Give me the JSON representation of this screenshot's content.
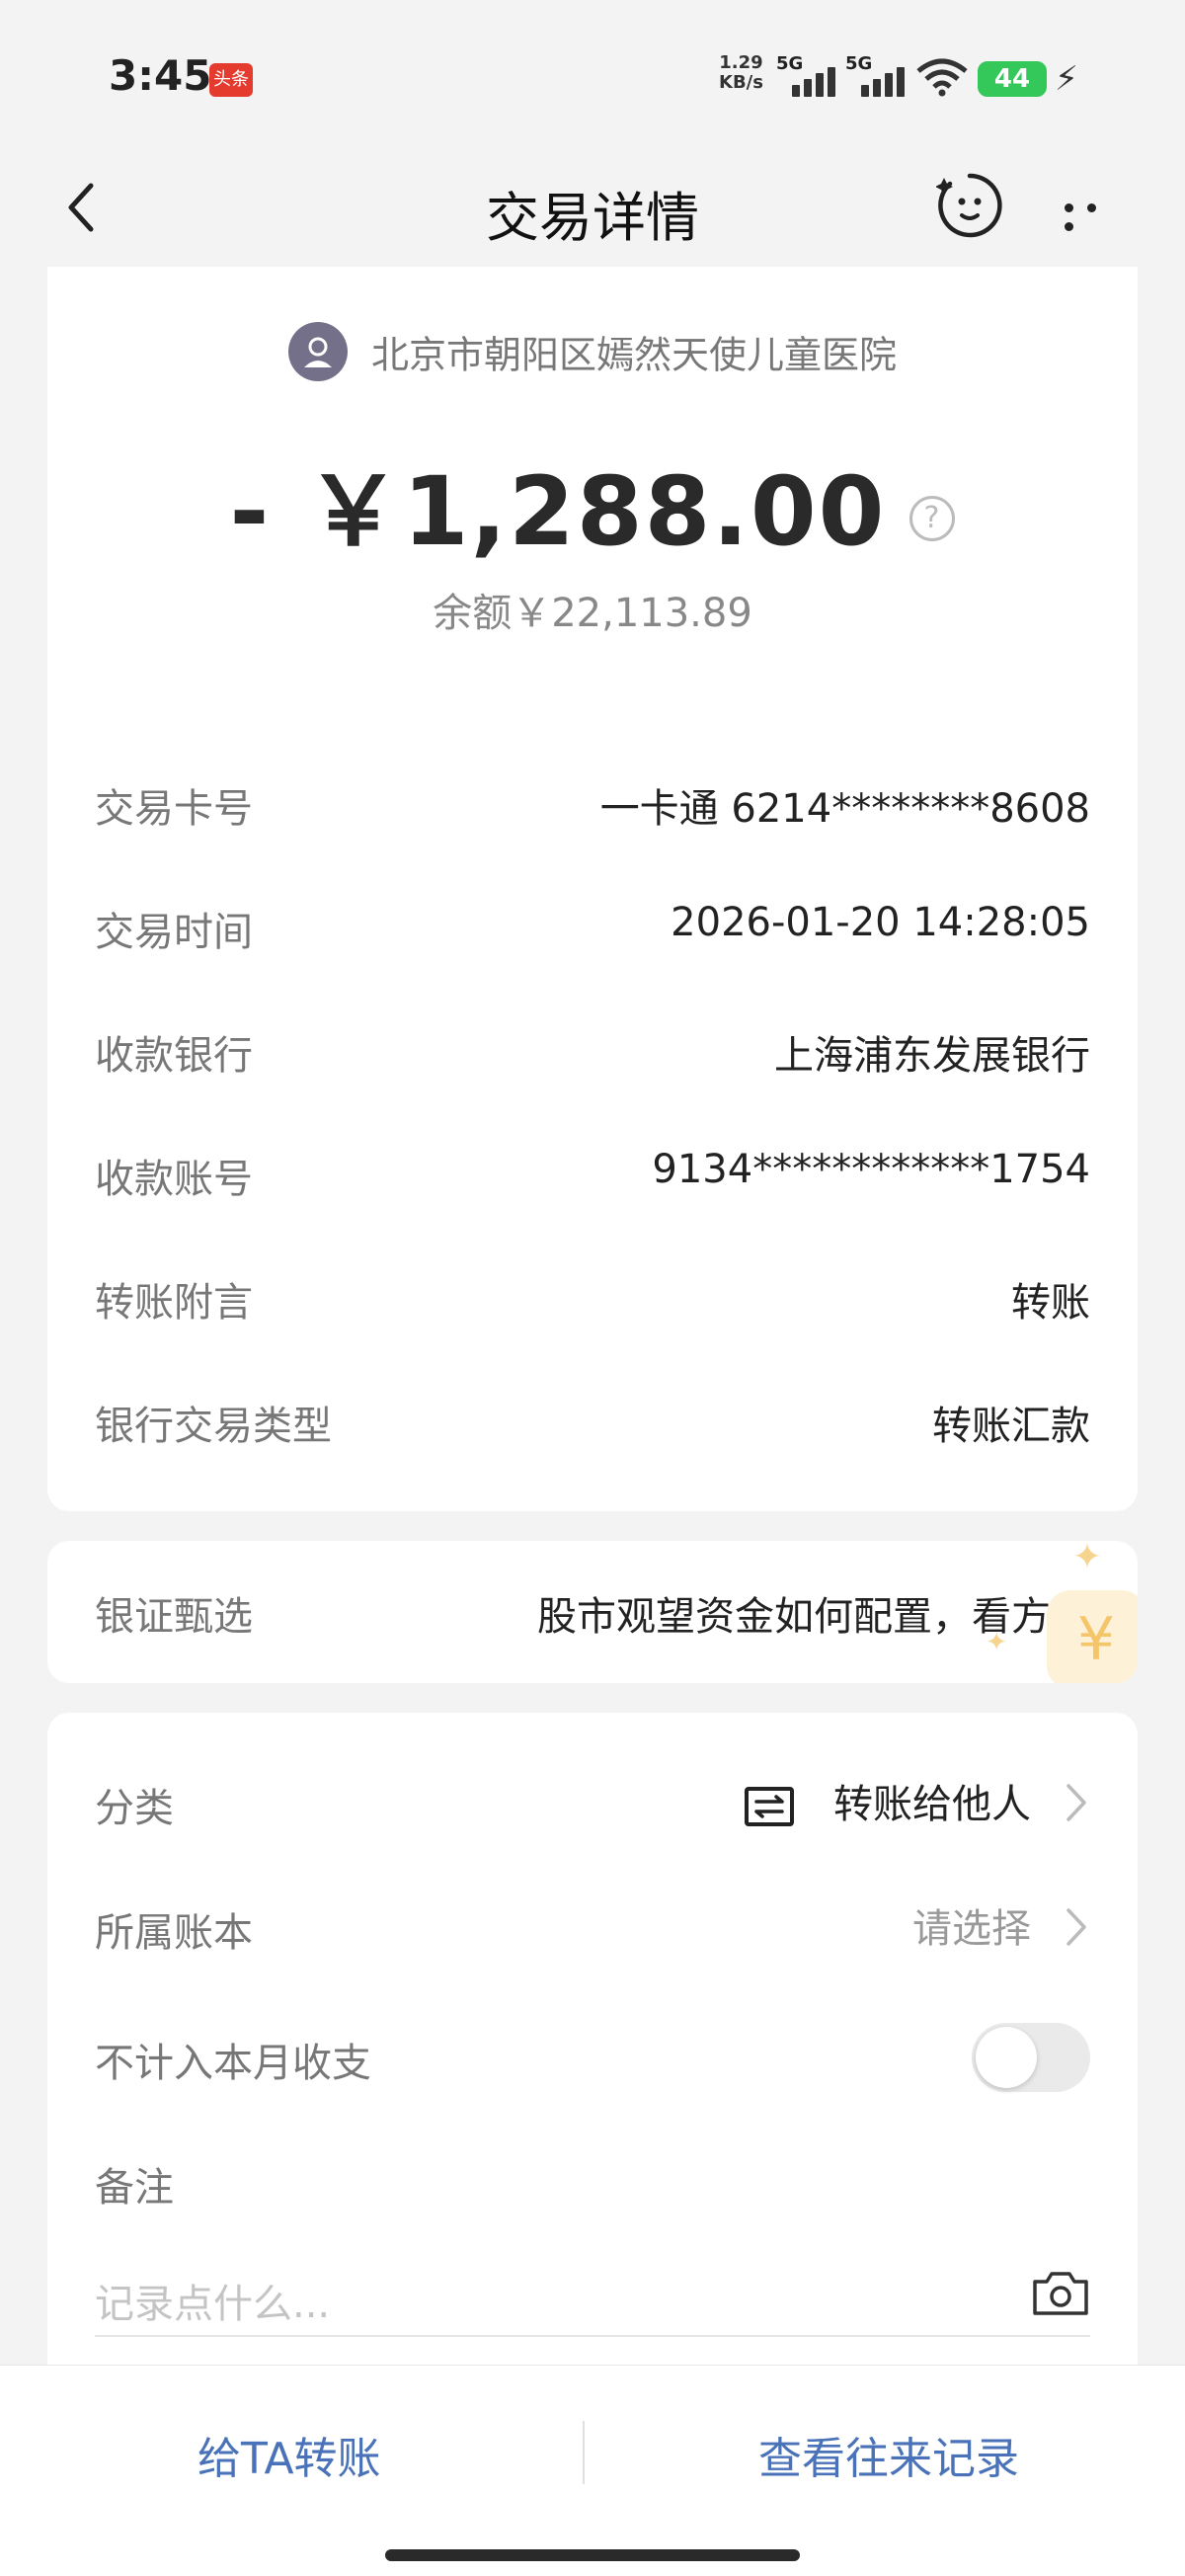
{
  "status_bar": {
    "time": "3:45",
    "app_badge": "头条",
    "net_speed_value": "1.29",
    "net_speed_unit": "KB/s",
    "sim1": "5G",
    "sim2": "5G",
    "battery": "44"
  },
  "nav": {
    "title": "交易详情"
  },
  "transaction": {
    "merchant": "北京市朝阳区嫣然天使儿童医院",
    "amount": "- ￥1,288.00",
    "balance": "余额￥22,113.89"
  },
  "details": [
    {
      "label": "交易卡号",
      "value": "一卡通 6214********8608"
    },
    {
      "label": "交易时间",
      "value": "2026-01-20 14:28:05"
    },
    {
      "label": "收款银行",
      "value": "上海浦东发展银行"
    },
    {
      "label": "收款账号",
      "value": "9134************1754"
    },
    {
      "label": "转账附言",
      "value": "转账"
    },
    {
      "label": "银行交易类型",
      "value": "转账汇款"
    }
  ],
  "promo": {
    "label": "银证甄选",
    "text": "股市观望资金如何配置，看方案"
  },
  "classification": {
    "category_label": "分类",
    "category_value": "转账给他人",
    "ledger_label": "所属账本",
    "ledger_value": "请选择",
    "exclude_label": "不计入本月收支",
    "exclude_enabled": false,
    "note_label": "备注",
    "note_placeholder": "记录点什么..."
  },
  "bottom": {
    "transfer_label": "给TA转账",
    "history_label": "查看往来记录"
  },
  "colors": {
    "accent": "#4a72b8",
    "battery": "#34c759"
  }
}
